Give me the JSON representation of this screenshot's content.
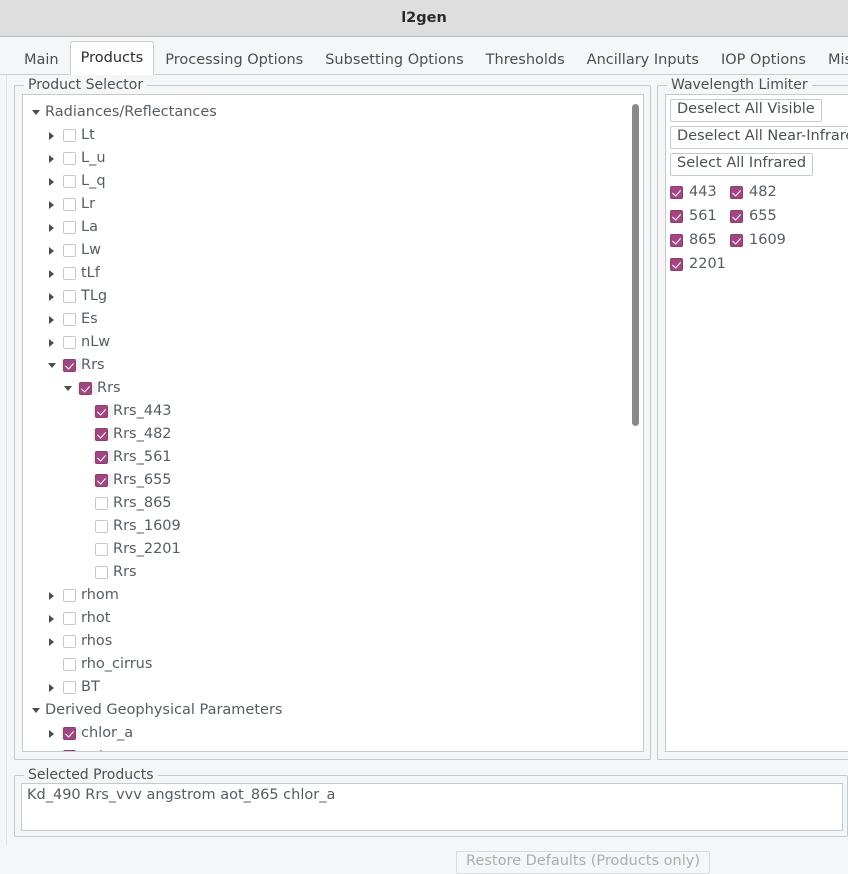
{
  "window": {
    "title": "l2gen"
  },
  "tabs": [
    {
      "label": "Main",
      "active": false
    },
    {
      "label": "Products",
      "active": true
    },
    {
      "label": "Processing Options",
      "active": false
    },
    {
      "label": "Subsetting Options",
      "active": false
    },
    {
      "label": "Thresholds",
      "active": false
    },
    {
      "label": "Ancillary Inputs",
      "active": false
    },
    {
      "label": "IOP Options",
      "active": false
    },
    {
      "label": "Miscellaneous",
      "active": false
    }
  ],
  "product_selector": {
    "legend": "Product Selector",
    "tree": [
      {
        "label": "Radiances/Reflectances",
        "indent": 0,
        "arrow": "down",
        "checkbox": "none"
      },
      {
        "label": "Lt",
        "indent": 1,
        "arrow": "right",
        "checkbox": "unchecked"
      },
      {
        "label": "L_u",
        "indent": 1,
        "arrow": "right",
        "checkbox": "unchecked"
      },
      {
        "label": "L_q",
        "indent": 1,
        "arrow": "right",
        "checkbox": "unchecked"
      },
      {
        "label": "Lr",
        "indent": 1,
        "arrow": "right",
        "checkbox": "unchecked"
      },
      {
        "label": "La",
        "indent": 1,
        "arrow": "right",
        "checkbox": "unchecked"
      },
      {
        "label": "Lw",
        "indent": 1,
        "arrow": "right",
        "checkbox": "unchecked"
      },
      {
        "label": "tLf",
        "indent": 1,
        "arrow": "right",
        "checkbox": "unchecked"
      },
      {
        "label": "TLg",
        "indent": 1,
        "arrow": "right",
        "checkbox": "unchecked"
      },
      {
        "label": "Es",
        "indent": 1,
        "arrow": "right",
        "checkbox": "unchecked"
      },
      {
        "label": "nLw",
        "indent": 1,
        "arrow": "right",
        "checkbox": "unchecked"
      },
      {
        "label": "Rrs",
        "indent": 1,
        "arrow": "down",
        "checkbox": "checked"
      },
      {
        "label": "Rrs",
        "indent": 2,
        "arrow": "down",
        "checkbox": "checked"
      },
      {
        "label": "Rrs_443",
        "indent": 3,
        "arrow": "none",
        "checkbox": "checked"
      },
      {
        "label": "Rrs_482",
        "indent": 3,
        "arrow": "none",
        "checkbox": "checked"
      },
      {
        "label": "Rrs_561",
        "indent": 3,
        "arrow": "none",
        "checkbox": "checked"
      },
      {
        "label": "Rrs_655",
        "indent": 3,
        "arrow": "none",
        "checkbox": "checked"
      },
      {
        "label": "Rrs_865",
        "indent": 3,
        "arrow": "none",
        "checkbox": "unchecked"
      },
      {
        "label": "Rrs_1609",
        "indent": 3,
        "arrow": "none",
        "checkbox": "unchecked"
      },
      {
        "label": "Rrs_2201",
        "indent": 3,
        "arrow": "none",
        "checkbox": "unchecked"
      },
      {
        "label": "Rrs",
        "indent": 3,
        "arrow": "none",
        "checkbox": "unchecked"
      },
      {
        "label": "rhom",
        "indent": 1,
        "arrow": "right",
        "checkbox": "unchecked"
      },
      {
        "label": "rhot",
        "indent": 1,
        "arrow": "right",
        "checkbox": "unchecked"
      },
      {
        "label": "rhos",
        "indent": 1,
        "arrow": "right",
        "checkbox": "unchecked"
      },
      {
        "label": "rho_cirrus",
        "indent": 1,
        "arrow": "none",
        "checkbox": "unchecked"
      },
      {
        "label": "BT",
        "indent": 1,
        "arrow": "right",
        "checkbox": "unchecked"
      },
      {
        "label": "Derived Geophysical Parameters",
        "indent": 0,
        "arrow": "down",
        "checkbox": "none"
      },
      {
        "label": "chlor_a",
        "indent": 1,
        "arrow": "right",
        "checkbox": "checked"
      },
      {
        "label": "aot",
        "indent": 1,
        "arrow": "right",
        "checkbox": "checked"
      }
    ]
  },
  "wavelength_limiter": {
    "legend": "Wavelength Limiter",
    "buttons": [
      {
        "label": "Deselect All Visible"
      },
      {
        "label": "Deselect All Near-Infrared"
      },
      {
        "label": "Select All Infrared"
      }
    ],
    "wavelengths": [
      {
        "label": "443",
        "checked": true
      },
      {
        "label": "482",
        "checked": true
      },
      {
        "label": "561",
        "checked": true
      },
      {
        "label": "655",
        "checked": true
      },
      {
        "label": "865",
        "checked": true
      },
      {
        "label": "1609",
        "checked": true
      },
      {
        "label": "2201",
        "checked": true
      }
    ]
  },
  "selected_products": {
    "legend": "Selected Products",
    "value": "Kd_490 Rrs_vvv angstrom aot_865 chlor_a"
  },
  "bottom": {
    "restore_label": "Restore Defaults (Products only)"
  },
  "colors": {
    "accent": "#a04680",
    "titlebar": "#dedede",
    "background": "#f4f6f7",
    "text": "#555d63",
    "border": "#c5cacd"
  }
}
